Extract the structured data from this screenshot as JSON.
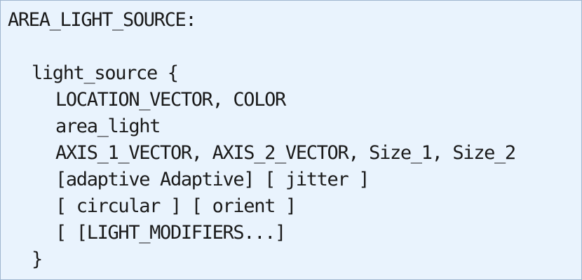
{
  "code": {
    "header": "AREA_LIGHT_SOURCE:",
    "open": "light_source {",
    "location_color": "LOCATION_VECTOR, COLOR",
    "area_light": "area_light",
    "axes_sizes": "AXIS_1_VECTOR, AXIS_2_VECTOR, Size_1, Size_2",
    "adaptive_jitter": "[adaptive Adaptive] [ jitter ]",
    "circular_orient": "[ circular ] [ orient ]",
    "modifiers": "[ [LIGHT_MODIFIERS...]",
    "close": "}"
  },
  "colors": {
    "background": "#e9f3fd",
    "border": "#9fb6cf",
    "text": "#1a1a1a"
  }
}
